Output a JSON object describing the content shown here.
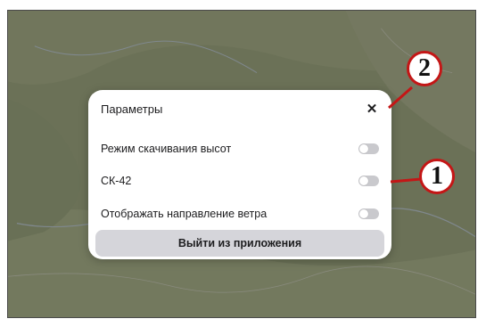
{
  "dialog": {
    "title": "Параметры",
    "close_glyph": "✕",
    "rows": [
      {
        "label": "Режим скачивания высот",
        "enabled": false
      },
      {
        "label": "СК-42",
        "enabled": false
      },
      {
        "label": "Отображать направление ветра",
        "enabled": false
      }
    ],
    "exit_label": "Выйти из приложения"
  },
  "callouts": [
    {
      "number": "1"
    },
    {
      "number": "2"
    }
  ],
  "colors": {
    "callout_ring": "#c41616",
    "toggle_off": "#c9c9cd",
    "exit_button_bg": "#d5d5da"
  }
}
